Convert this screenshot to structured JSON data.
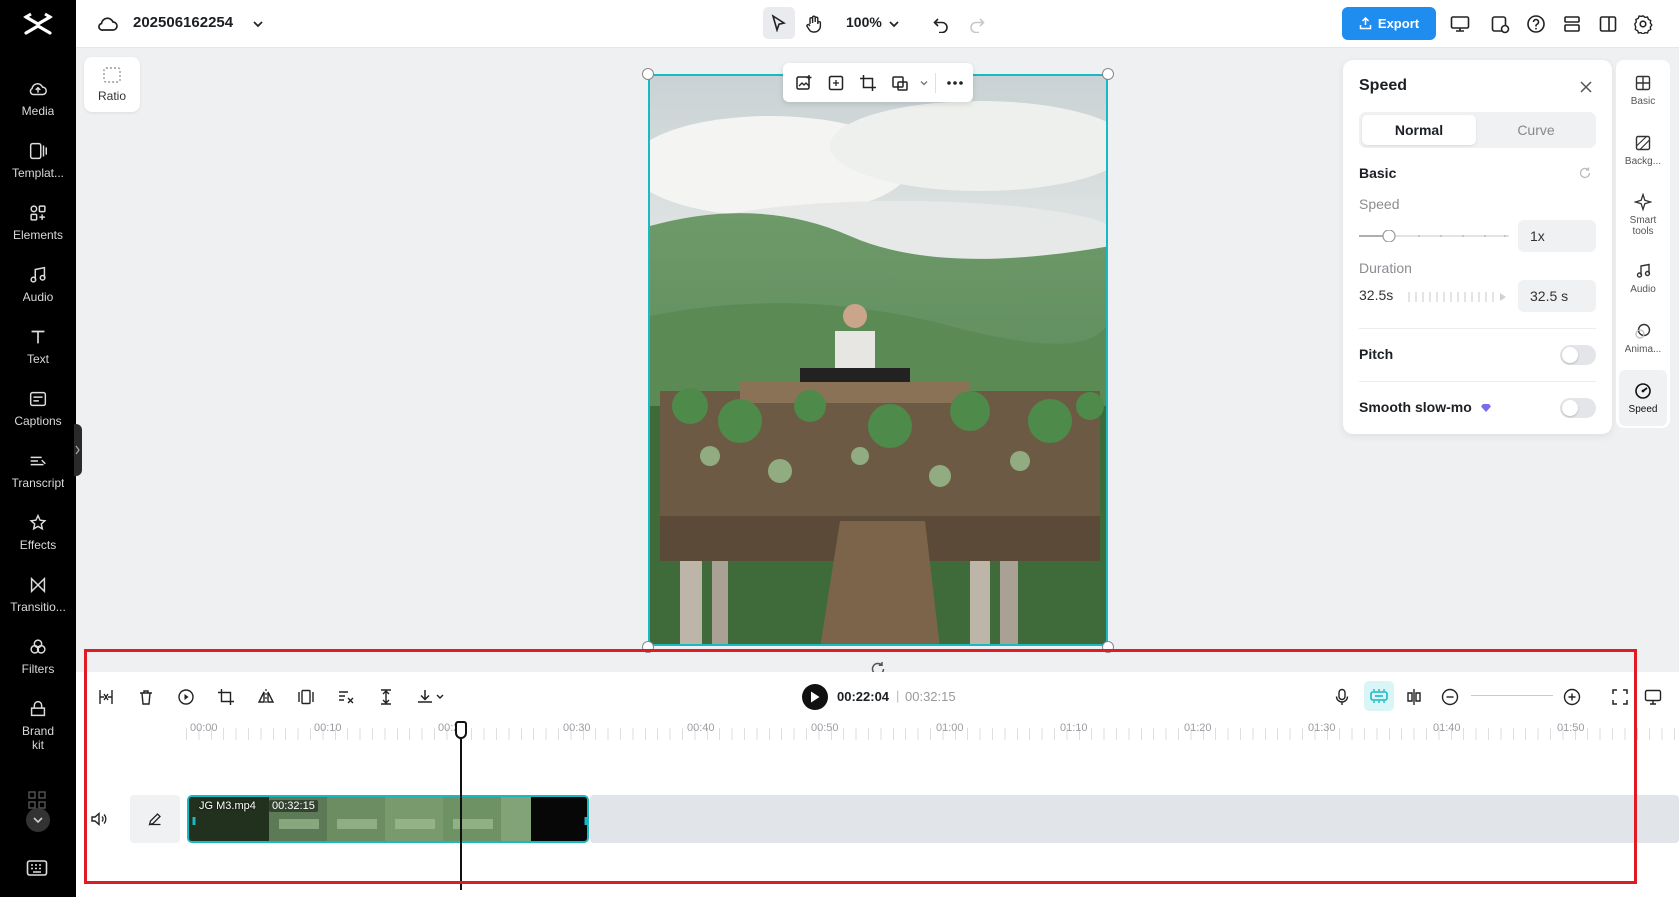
{
  "app": {
    "logo": "capcut-logo"
  },
  "sidebar": {
    "items": [
      {
        "label": "Media",
        "icon": "cloud-upload-icon"
      },
      {
        "label": "Templat...",
        "icon": "template-icon"
      },
      {
        "label": "Elements",
        "icon": "elements-icon"
      },
      {
        "label": "Audio",
        "icon": "music-note-icon"
      },
      {
        "label": "Text",
        "icon": "text-icon"
      },
      {
        "label": "Captions",
        "icon": "captions-icon"
      },
      {
        "label": "Transcript",
        "icon": "transcript-icon"
      },
      {
        "label": "Effects",
        "icon": "effects-icon"
      },
      {
        "label": "Transitio...",
        "icon": "transition-icon"
      },
      {
        "label": "Filters",
        "icon": "filters-icon"
      },
      {
        "label": "Brand kit",
        "icon": "brand-kit-icon"
      }
    ]
  },
  "topbar": {
    "project_name": "202506162254",
    "zoom": "100%",
    "export_label": "Export"
  },
  "canvas": {
    "ratio_label": "Ratio"
  },
  "speed_panel": {
    "title": "Speed",
    "tabs": {
      "normal": "Normal",
      "curve": "Curve"
    },
    "section": "Basic",
    "speed_label": "Speed",
    "speed_value": "1x",
    "duration_label": "Duration",
    "duration_left": "32.5s",
    "duration_value": "32.5 s",
    "pitch_label": "Pitch",
    "pitch_on": false,
    "smooth_label": "Smooth slow-mo",
    "smooth_on": false
  },
  "right_tabs": [
    {
      "label": "Basic",
      "icon": "basic-icon"
    },
    {
      "label": "Backg...",
      "icon": "background-icon"
    },
    {
      "label": "Smart tools",
      "icon": "smart-tools-icon"
    },
    {
      "label": "Audio",
      "icon": "audio-icon"
    },
    {
      "label": "Anima...",
      "icon": "animation-icon"
    },
    {
      "label": "Speed",
      "icon": "speed-icon",
      "active": true
    }
  ],
  "timeline": {
    "current_time": "00:22:04",
    "separator": "|",
    "total_time": "00:32:15",
    "ruler": [
      "00:00",
      "00:10",
      "00:20",
      "00:30",
      "00:40",
      "00:50",
      "01:00",
      "01:10",
      "01:20",
      "01:30",
      "01:40",
      "01:50"
    ],
    "clip": {
      "name": "JG M3.mp4",
      "duration": "00:32:15"
    }
  },
  "colors": {
    "accent": "#17b9c4",
    "export": "#1f8cf0",
    "highlight": "#e01b24"
  }
}
